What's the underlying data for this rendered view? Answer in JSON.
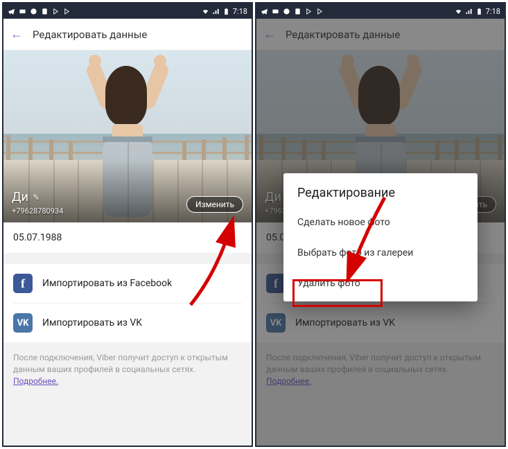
{
  "status": {
    "time": "7:18",
    "icons_left": [
      "telegram-icon",
      "card-icon",
      "viber-icon",
      "dual-sim-icon",
      "arrow1-icon",
      "arrow2-icon"
    ],
    "icons_right": [
      "wifi-icon",
      "signal-icon",
      "battery-icon"
    ]
  },
  "toolbar": {
    "title": "Редактировать данные"
  },
  "profile": {
    "name": "Ди",
    "phone": "+79628780934",
    "change_label": "Изменить",
    "birthdate": "05.07.1988"
  },
  "social": {
    "facebook_label": "Импортировать из Facebook",
    "vk_label": "Импортировать из VK"
  },
  "footer": {
    "note": "После подключения, Viber получит доступ к открытым данным ваших профилей в социальных сетях.",
    "link": "Подробнее."
  },
  "dialog": {
    "title": "Редактирование",
    "items": [
      "Сделать новое фото",
      "Выбрать фото из галереи",
      "Удалить фото"
    ]
  }
}
